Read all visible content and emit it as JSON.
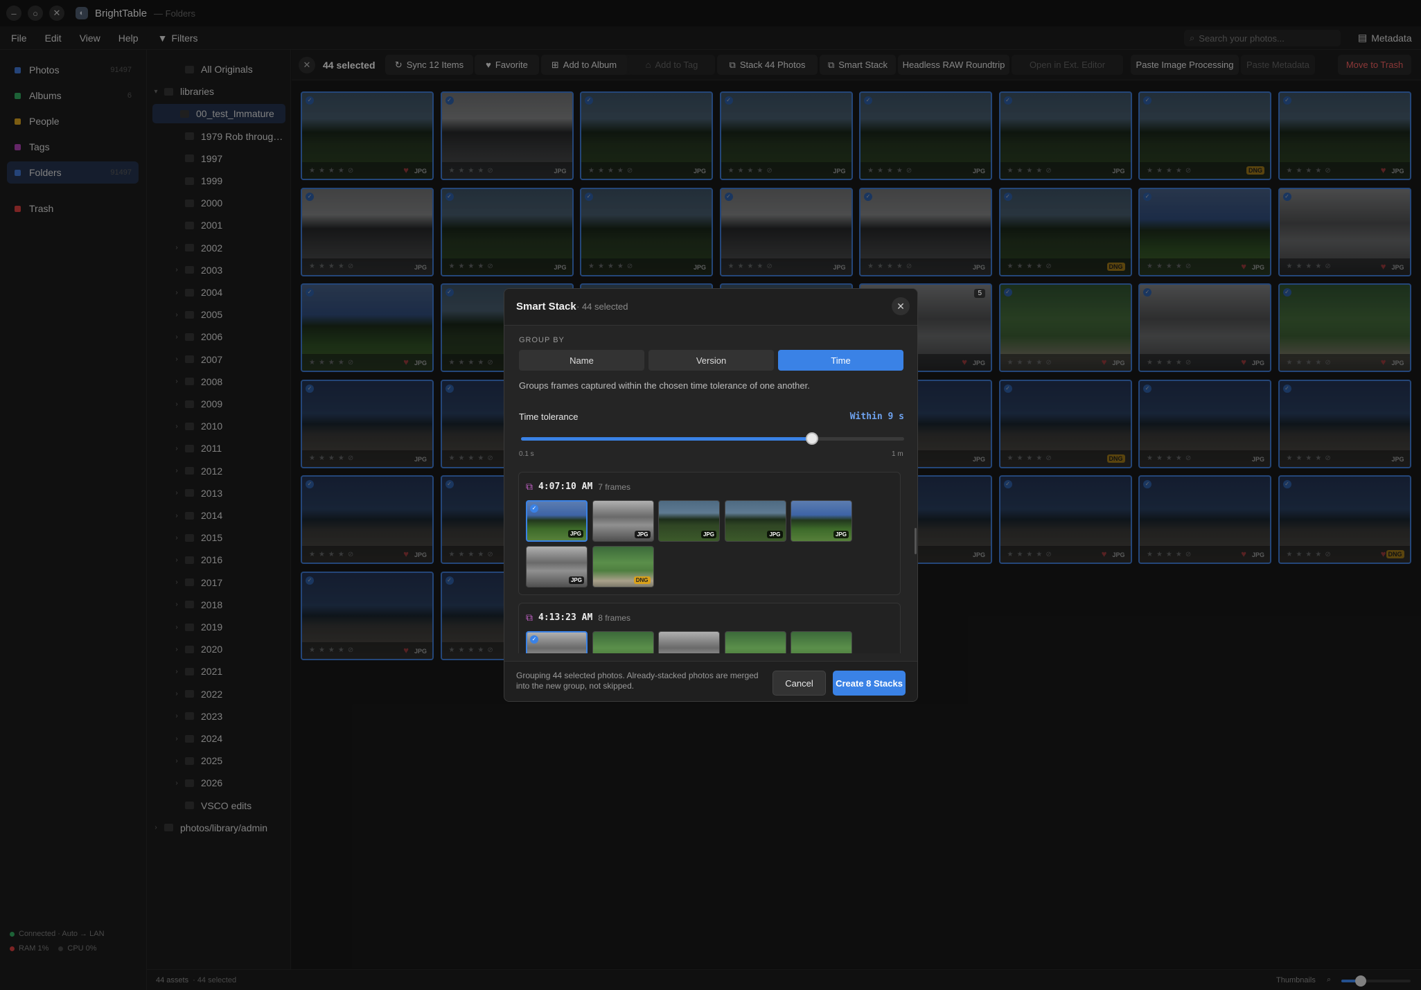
{
  "window": {
    "app_name": "BrightTable",
    "subtitle": "— Folders"
  },
  "menu": {
    "items": [
      "File",
      "Edit",
      "View",
      "Help"
    ],
    "filters": "Filters"
  },
  "search": {
    "placeholder": "Search your photos..."
  },
  "metadata_button": "Metadata",
  "sidebar": {
    "items": [
      {
        "label": "Photos",
        "count": "91497",
        "color": "#3d6fc4"
      },
      {
        "label": "Albums",
        "count": "6",
        "color": "#2f9e5a"
      },
      {
        "label": "People",
        "count": "",
        "color": "#c8961e"
      },
      {
        "label": "Tags",
        "count": "",
        "color": "#a23ea6"
      },
      {
        "label": "Folders",
        "count": "91497",
        "color": "#3d6fc4"
      },
      {
        "label": "Trash",
        "count": "",
        "color": "#c83a3a"
      }
    ],
    "status": {
      "connection": "Connected · Auto → LAN",
      "ram": "RAM 1%",
      "cpu": "CPU 0%"
    }
  },
  "tree": {
    "items": [
      "All Originals",
      "libraries",
      "00_test_Immature",
      "1979 Rob throug…",
      "1997",
      "1999",
      "2000",
      "2001",
      "2002",
      "2003",
      "2004",
      "2005",
      "2006",
      "2007",
      "2008",
      "2009",
      "2010",
      "2011",
      "2012",
      "2013",
      "2014",
      "2015",
      "2016",
      "2017",
      "2018",
      "2019",
      "2020",
      "2021",
      "2022",
      "2023",
      "2024",
      "2025",
      "2026",
      "VSCO edits",
      "photos/library/admin"
    ]
  },
  "actionbar": {
    "selected": "44 selected",
    "rating_count": "0",
    "buttons": [
      "Sync 12 Items",
      "Favorite",
      "Add to Album",
      "Add to Tag",
      "Stack 44 Photos",
      "Smart Stack",
      "Headless RAW Roundtrip",
      "Open in Ext. Editor",
      "Paste Image Processing",
      "Paste Metadata",
      "Move to Trash"
    ]
  },
  "grid": {
    "format_jpg": "JPG",
    "format_dng": "DNG",
    "stack_badge": "5"
  },
  "modal": {
    "title": "Smart Stack",
    "subtitle": "· 44 selected",
    "group_by_label": "GROUP BY",
    "options": [
      "Name",
      "Version",
      "Time"
    ],
    "active_option": "Time",
    "description": "Groups frames captured within the chosen time tolerance of one another.",
    "tolerance_label": "Time tolerance",
    "tolerance_value": "Within 9 s",
    "slider_fraction": 0.76,
    "slider_min": "0.1 s",
    "slider_max": "1 m",
    "groups": [
      {
        "time": "4:07:10 AM",
        "frames": "7 frames",
        "formats": [
          "JPG",
          "JPG",
          "JPG",
          "JPG",
          "JPG",
          "JPG",
          "DNG"
        ]
      },
      {
        "time": "4:13:23 AM",
        "frames": "8 frames",
        "formats": [
          "",
          "",
          "",
          "",
          ""
        ]
      }
    ],
    "footnote": "Grouping 44 selected photos. Already-stacked photos are merged into the new group, not skipped.",
    "cancel": "Cancel",
    "create": "Create 8 Stacks"
  },
  "bottom": {
    "assets": "44 assets",
    "selected": "· 44 selected",
    "thumbnails": "Thumbnails",
    "zoom_fraction": 0.28
  }
}
